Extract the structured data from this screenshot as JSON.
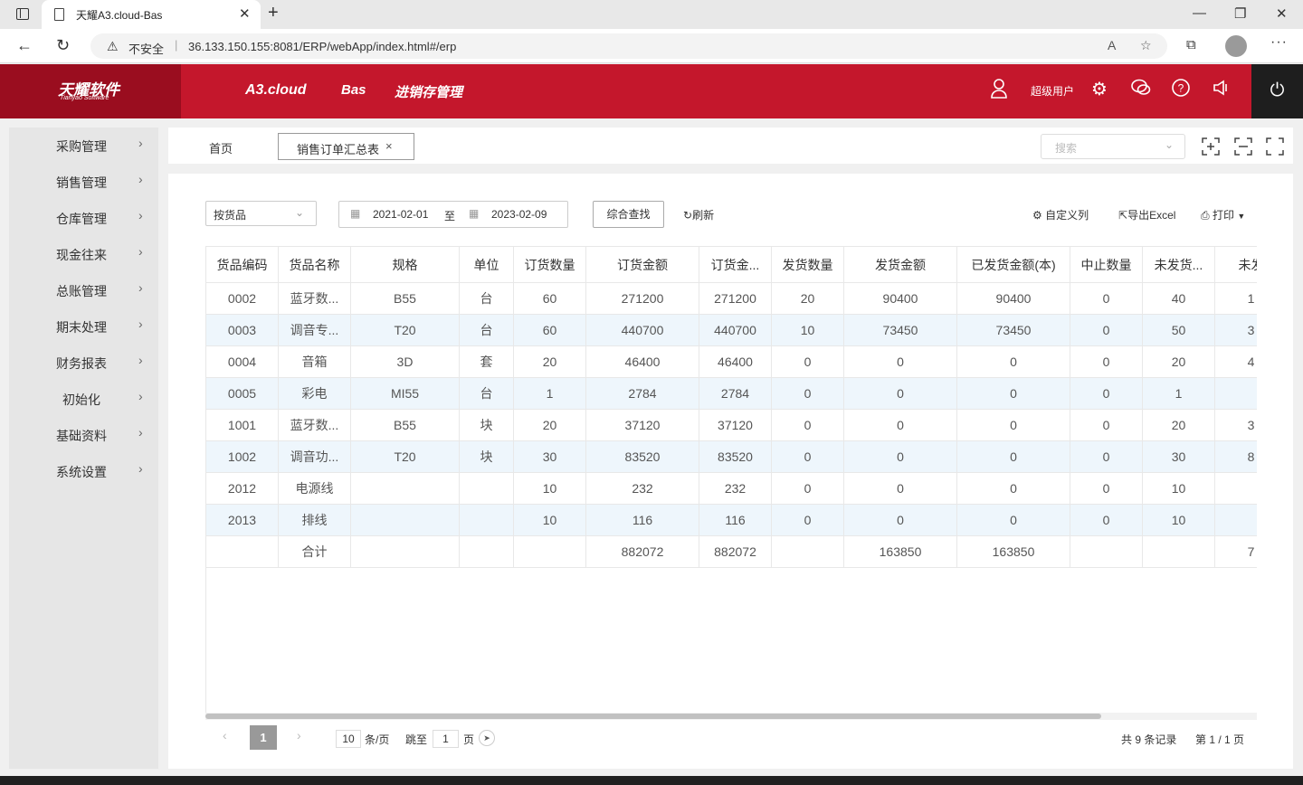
{
  "browser": {
    "tab_title": "天耀A3.cloud-Bas",
    "tab_close": "✕",
    "new_tab": "+",
    "insecure_label": "不安全",
    "url": "36.133.150.155:8081/ERP/webApp/index.html#/erp"
  },
  "header": {
    "logo_cn": "天耀软件",
    "logo_en": "Tianyao Software",
    "nav": [
      "A3.cloud",
      "Bas",
      "进销存管理"
    ],
    "user_label": "超级用户",
    "accent_color": "#c4172c"
  },
  "sidebar": {
    "items": [
      {
        "label": "采购管理"
      },
      {
        "label": "销售管理"
      },
      {
        "label": "仓库管理"
      },
      {
        "label": "现金往来"
      },
      {
        "label": "总账管理"
      },
      {
        "label": "期末处理"
      },
      {
        "label": "财务报表"
      },
      {
        "label": "初始化"
      },
      {
        "label": "基础资料"
      },
      {
        "label": "系统设置"
      }
    ]
  },
  "tabs": {
    "home": "首页",
    "active": "销售订单汇总表",
    "close": "×",
    "search_placeholder": "搜索"
  },
  "toolbar": {
    "group_by": "按货品",
    "date_from": "2021-02-01",
    "date_to_label": "至",
    "date_to": "2023-02-09",
    "search_button": "综合查找",
    "refresh": "刷新",
    "custom_columns": "自定义列",
    "export": "导出Excel",
    "print": "打印"
  },
  "table": {
    "headers": [
      "货品编码",
      "货品名称",
      "规格",
      "单位",
      "订货数量",
      "订货金额",
      "订货金...",
      "发货数量",
      "发货金额",
      "已发货金额(本)",
      "中止数量",
      "未发货...",
      "未发"
    ],
    "rows": [
      [
        "0002",
        "蓝牙数...",
        "B55",
        "台",
        "60",
        "271200",
        "271200",
        "20",
        "90400",
        "90400",
        "0",
        "40",
        "1"
      ],
      [
        "0003",
        "调音专...",
        "T20",
        "台",
        "60",
        "440700",
        "440700",
        "10",
        "73450",
        "73450",
        "0",
        "50",
        "3"
      ],
      [
        "0004",
        "音箱",
        "3D",
        "套",
        "20",
        "46400",
        "46400",
        "0",
        "0",
        "0",
        "0",
        "20",
        "4"
      ],
      [
        "0005",
        "彩电",
        "MI55",
        "台",
        "1",
        "2784",
        "2784",
        "0",
        "0",
        "0",
        "0",
        "1",
        ""
      ],
      [
        "1001",
        "蓝牙数...",
        "B55",
        "块",
        "20",
        "37120",
        "37120",
        "0",
        "0",
        "0",
        "0",
        "20",
        "3"
      ],
      [
        "1002",
        "调音功...",
        "T20",
        "块",
        "30",
        "83520",
        "83520",
        "0",
        "0",
        "0",
        "0",
        "30",
        "8"
      ],
      [
        "2012",
        "电源线",
        "",
        "",
        "10",
        "232",
        "232",
        "0",
        "0",
        "0",
        "0",
        "10",
        ""
      ],
      [
        "2013",
        "排线",
        "",
        "",
        "10",
        "116",
        "116",
        "0",
        "0",
        "0",
        "0",
        "10",
        ""
      ]
    ],
    "total_row": [
      "",
      "合计",
      "",
      "",
      "",
      "882072",
      "882072",
      "",
      "163850",
      "163850",
      "",
      "",
      "7"
    ]
  },
  "pagination": {
    "current_page": "1",
    "page_size": "10",
    "per_page_label": "条/页",
    "jump_label": "跳至",
    "jump_value": "1",
    "page_label": "页",
    "total_records": "共 9 条记录",
    "page_info": "第 1 / 1 页"
  }
}
